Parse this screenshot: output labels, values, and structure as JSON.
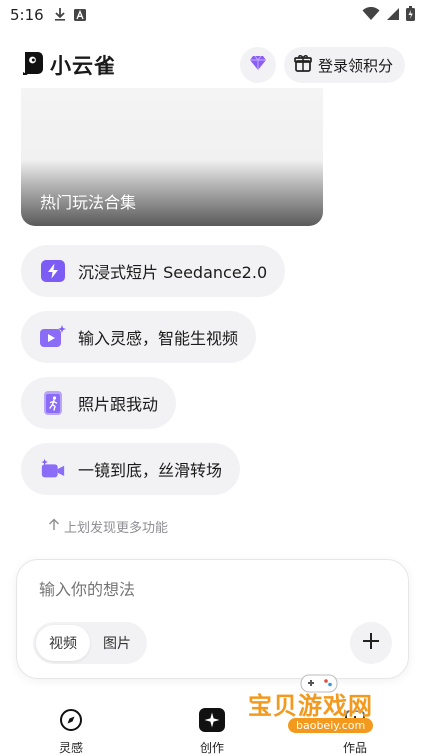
{
  "status_bar": {
    "time": "5:16",
    "left_icons": [
      "download-icon",
      "notification-a-icon"
    ],
    "right_icons": [
      "wifi-icon",
      "signal-icon",
      "battery-icon"
    ]
  },
  "header": {
    "brand_name": "小云雀",
    "brand_icon": "brand-logo-icon",
    "vip_icon": "diamond-icon",
    "login_label": "登录领积分",
    "login_icon": "gift-icon",
    "accent_color": "#8b5cf6"
  },
  "banner": {
    "title": "热门玩法合集"
  },
  "features": [
    {
      "label": "沉浸式短片 Seedance2.0",
      "icon": "lightning-icon"
    },
    {
      "label": "输入灵感，智能生视频",
      "icon": "video-sparkle-icon"
    },
    {
      "label": "照片跟我动",
      "icon": "running-figure-icon"
    },
    {
      "label": "一镜到底，丝滑转场",
      "icon": "camera-sparkle-icon"
    }
  ],
  "more_hint": "上划发现更多功能",
  "composer": {
    "placeholder": "输入你的想法",
    "modes": [
      "视频",
      "图片"
    ],
    "selected_mode": "视频",
    "add_icon": "plus-icon"
  },
  "bottom_nav": [
    {
      "label": "灵感",
      "icon": "compass-icon"
    },
    {
      "label": "创作",
      "icon": "sparkle-icon"
    },
    {
      "label": "作品",
      "icon": "works-icon"
    }
  ],
  "watermark": {
    "main": "宝贝游戏网",
    "sub": "baobeiy.com"
  }
}
